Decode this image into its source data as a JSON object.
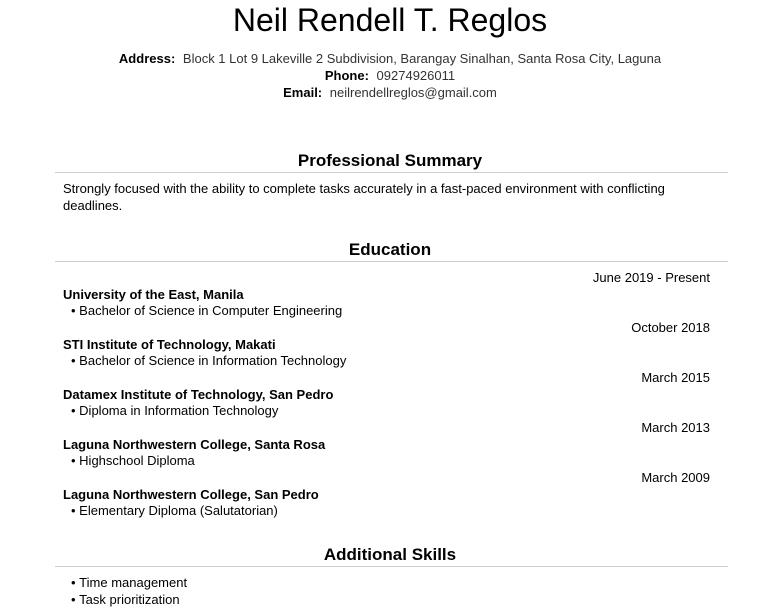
{
  "header": {
    "name": "Neil Rendell T. Reglos",
    "address_label": "Address:",
    "address": "Block 1 Lot 9 Lakeville 2 Subdivision, Barangay Sinalhan, Santa Rosa City, Laguna",
    "phone_label": "Phone:",
    "phone": "09274926011",
    "email_label": "Email:",
    "email": "neilrendellreglos@gmail.com"
  },
  "summary": {
    "title": "Professional Summary",
    "text": "Strongly focused with the ability to complete tasks accurately in a fast-paced environment with conflicting deadlines."
  },
  "education": {
    "title": "Education",
    "entries": [
      {
        "date": "June 2019 - Present",
        "school": "University of the East, Manila",
        "degree": "Bachelor of Science in Computer Engineering"
      },
      {
        "date": "October 2018",
        "school": "STI Institute of Technology, Makati",
        "degree": "Bachelor of Science in Information Technology"
      },
      {
        "date": "March 2015",
        "school": "Datamex Institute of Technology, San Pedro",
        "degree": "Diploma in Information Technology"
      },
      {
        "date": "March 2013",
        "school": "Laguna Northwestern College, Santa Rosa",
        "degree": "Highschool Diploma"
      },
      {
        "date": "March 2009",
        "school": "Laguna Northwestern College, San Pedro",
        "degree": "Elementary Diploma (Salutatorian)"
      }
    ]
  },
  "skills": {
    "title": "Additional Skills",
    "items": [
      "Time management",
      "Task prioritization"
    ]
  }
}
